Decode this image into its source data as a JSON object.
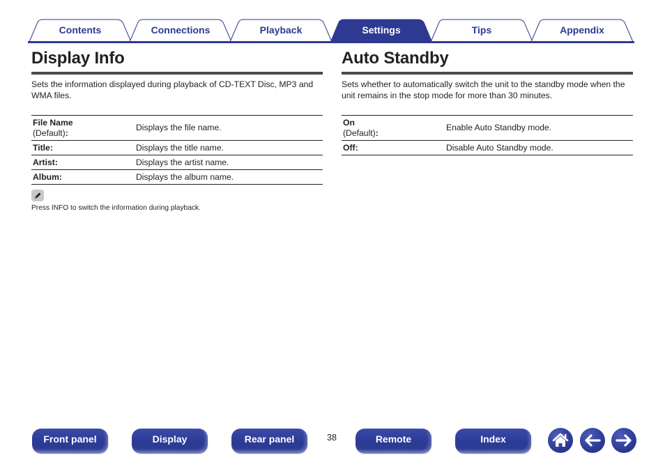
{
  "tabs": [
    {
      "label": "Contents",
      "active": false
    },
    {
      "label": "Connections",
      "active": false
    },
    {
      "label": "Playback",
      "active": false
    },
    {
      "label": "Settings",
      "active": true
    },
    {
      "label": "Tips",
      "active": false
    },
    {
      "label": "Appendix",
      "active": false
    }
  ],
  "colors": {
    "accent": "#2e3a92",
    "tab_outline": "#2e3a92",
    "text": "#231f20",
    "rule": "#4a4a4c",
    "note_icon_bg": "#c8c8c9"
  },
  "display_info": {
    "title": "Display Info",
    "description": "Sets the information displayed during playback of CD-TEXT Disc, MP3 and WMA files.",
    "rows": [
      {
        "key": "File Name",
        "default": "(Default)",
        "colon": ":",
        "value": "Displays the file name."
      },
      {
        "key": "Title:",
        "value": "Displays the title name."
      },
      {
        "key": "Artist:",
        "value": "Displays the artist name."
      },
      {
        "key": "Album:",
        "value": "Displays the album name."
      }
    ],
    "note_icon": "pencil-icon",
    "note": "Press INFO to switch the information during playback."
  },
  "auto_standby": {
    "title": "Auto Standby",
    "description": "Sets whether to automatically switch the unit to the standby mode when the unit remains in the stop mode for more than 30 minutes.",
    "rows": [
      {
        "key": "On",
        "default": "(Default)",
        "colon": ":",
        "value": "Enable Auto Standby mode."
      },
      {
        "key": "Off:",
        "value": "Disable Auto Standby mode."
      }
    ]
  },
  "footer": {
    "buttons": [
      "Front panel",
      "Display",
      "Rear panel",
      "Remote",
      "Index"
    ],
    "page_number": "38",
    "icons": [
      "home-icon",
      "arrow-left-icon",
      "arrow-right-icon"
    ]
  }
}
